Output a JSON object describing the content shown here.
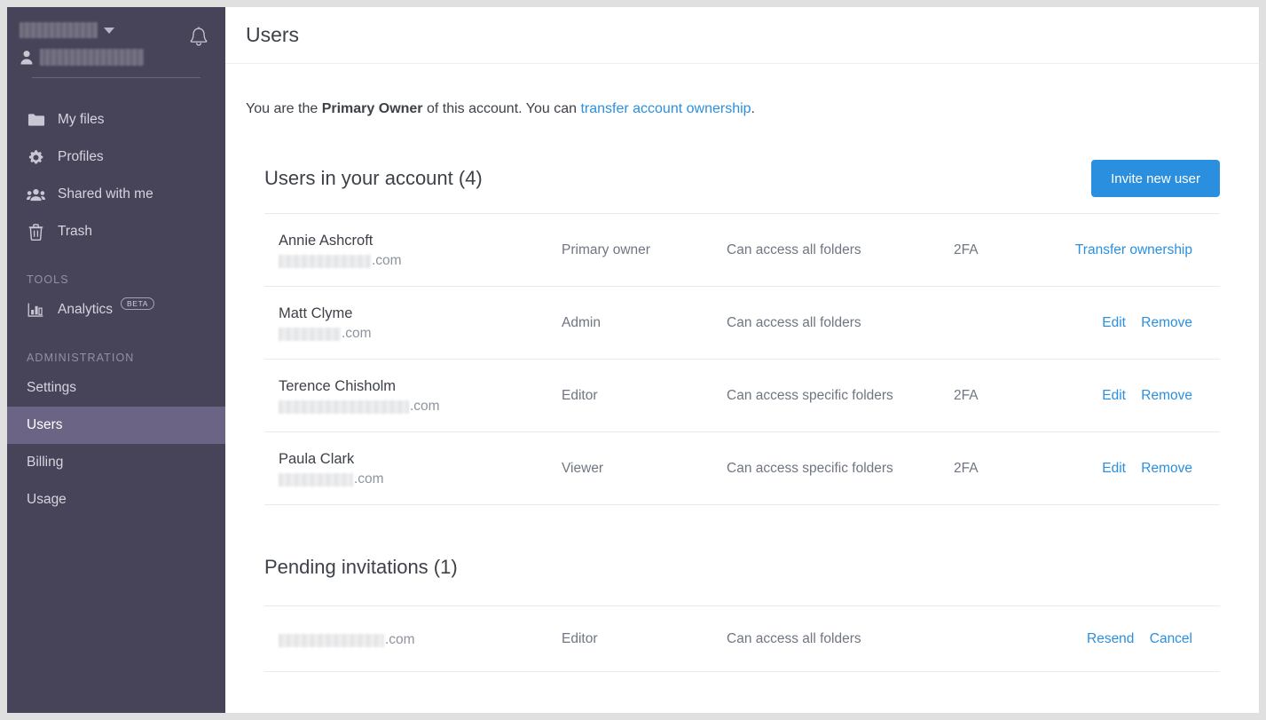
{
  "sidebar": {
    "account_switcher": {
      "name_redacted": true,
      "caret_icon": "chevron-down-icon"
    },
    "user_chip": {
      "avatar_icon": "person-icon",
      "name_redacted": true
    },
    "notifications_icon": "bell-icon",
    "nav": [
      {
        "label": "My files",
        "icon": "folder-icon",
        "selected": false
      },
      {
        "label": "Profiles",
        "icon": "gear-icon",
        "selected": false
      },
      {
        "label": "Shared with me",
        "icon": "people-icon",
        "selected": false
      },
      {
        "label": "Trash",
        "icon": "trash-icon",
        "selected": false
      }
    ],
    "tools_label": "TOOLS",
    "tools": [
      {
        "label": "Analytics",
        "icon": "bar-chart-icon",
        "badge": "BETA",
        "selected": false
      }
    ],
    "administration_label": "ADMINISTRATION",
    "administration": [
      {
        "label": "Settings",
        "selected": false
      },
      {
        "label": "Users",
        "selected": true
      },
      {
        "label": "Billing",
        "selected": false
      },
      {
        "label": "Usage",
        "selected": false
      }
    ]
  },
  "header": {
    "title": "Users"
  },
  "banner": {
    "text_before": "You are the ",
    "role": "Primary Owner",
    "text_middle": " of this account. You can ",
    "link": "transfer account ownership",
    "text_after": "."
  },
  "users_section": {
    "title": "Users in your account  (4)",
    "invite_button": "Invite new user",
    "rows": [
      {
        "name": "Annie Ashcroft",
        "email_tld": ".com",
        "email_blur_width": 104,
        "role": "Primary owner",
        "folders": "Can access all folders",
        "twofa": "2FA",
        "actions": [
          "Transfer ownership"
        ]
      },
      {
        "name": "Matt Clyme",
        "email_tld": ".com",
        "email_blur_width": 70,
        "role": "Admin",
        "folders": "Can access all folders",
        "twofa": "",
        "actions": [
          "Edit",
          "Remove"
        ]
      },
      {
        "name": "Terence Chisholm",
        "email_tld": ".com",
        "email_blur_width": 147,
        "role": "Editor",
        "folders": "Can access specific folders",
        "twofa": "2FA",
        "actions": [
          "Edit",
          "Remove"
        ]
      },
      {
        "name": "Paula Clark",
        "email_tld": ".com",
        "email_blur_width": 84,
        "role": "Viewer",
        "folders": "Can access specific folders",
        "twofa": "2FA",
        "actions": [
          "Edit",
          "Remove"
        ]
      }
    ]
  },
  "pending_section": {
    "title": "Pending invitations (1)",
    "rows": [
      {
        "name": "",
        "email_tld": ".com",
        "email_blur_width": 119,
        "role": "Editor",
        "folders": "Can access all folders",
        "twofa": "",
        "actions": [
          "Resend",
          "Cancel"
        ]
      }
    ]
  },
  "colors": {
    "sidebar_bg": "#474459",
    "sidebar_selected": "#6b6485",
    "accent_blue": "#2b8fdf",
    "text_dark": "#3d4148",
    "text_muted": "#6f7681"
  }
}
